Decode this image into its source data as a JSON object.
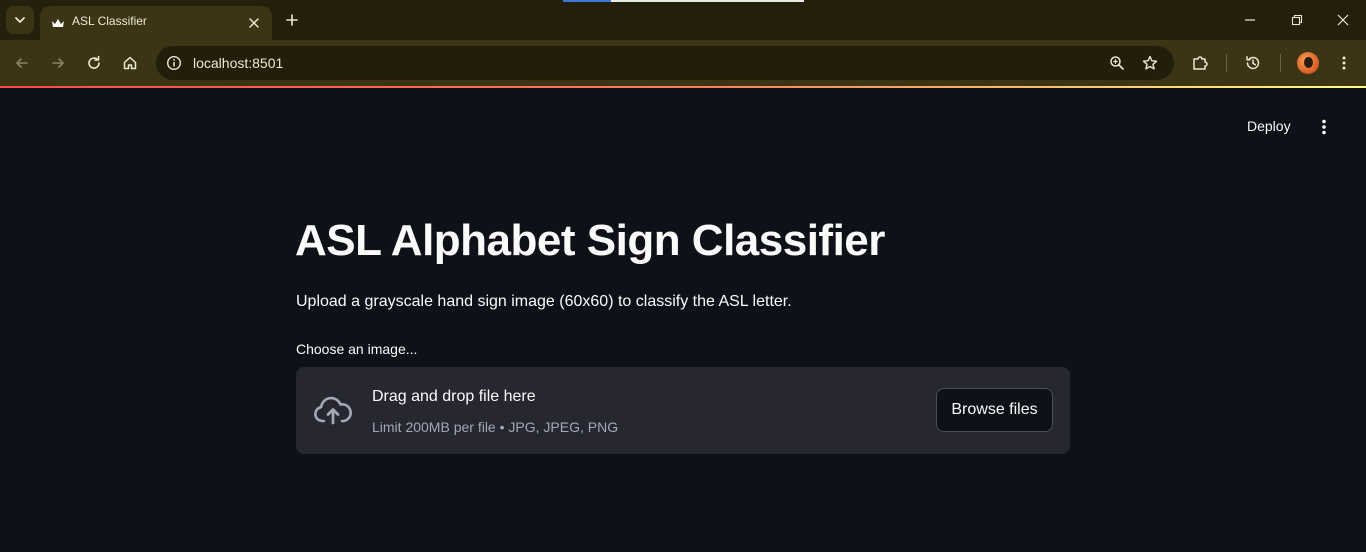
{
  "browser": {
    "tab_title": "ASL Classifier",
    "url": "localhost:8501",
    "icons": {
      "tab_search": "chevron-down-icon",
      "tab_close": "close-icon",
      "new_tab": "plus-icon",
      "minimize": "minimize-icon",
      "restore": "restore-icon",
      "close_window": "close-icon",
      "back": "arrow-left-icon",
      "forward": "arrow-right-icon",
      "reload": "reload-icon",
      "home": "home-icon",
      "site_info": "info-icon",
      "zoom": "zoom-icon",
      "bookmark": "star-icon",
      "extensions": "puzzle-icon",
      "history": "history-icon",
      "profile": "avatar",
      "menu": "kebab-icon"
    }
  },
  "app": {
    "header": {
      "deploy_label": "Deploy",
      "menu_icon": "kebab-icon"
    },
    "title": "ASL Alphabet Sign Classifier",
    "description": "Upload a grayscale hand sign image (60x60) to classify the ASL letter.",
    "uploader": {
      "label": "Choose an image...",
      "drop_text": "Drag and drop file here",
      "limit_text": "Limit 200MB per file • JPG, JPEG, PNG",
      "browse_label": "Browse files",
      "icon": "cloud-upload-icon"
    }
  },
  "colors": {
    "app_background": "#0e1117",
    "dropzone_background": "#262730",
    "chrome_tabstrip": "#241f0c",
    "chrome_toolbar": "#3b3515",
    "accent_gradient_start": "#ff4b4b",
    "accent_gradient_end": "#fffd80"
  }
}
